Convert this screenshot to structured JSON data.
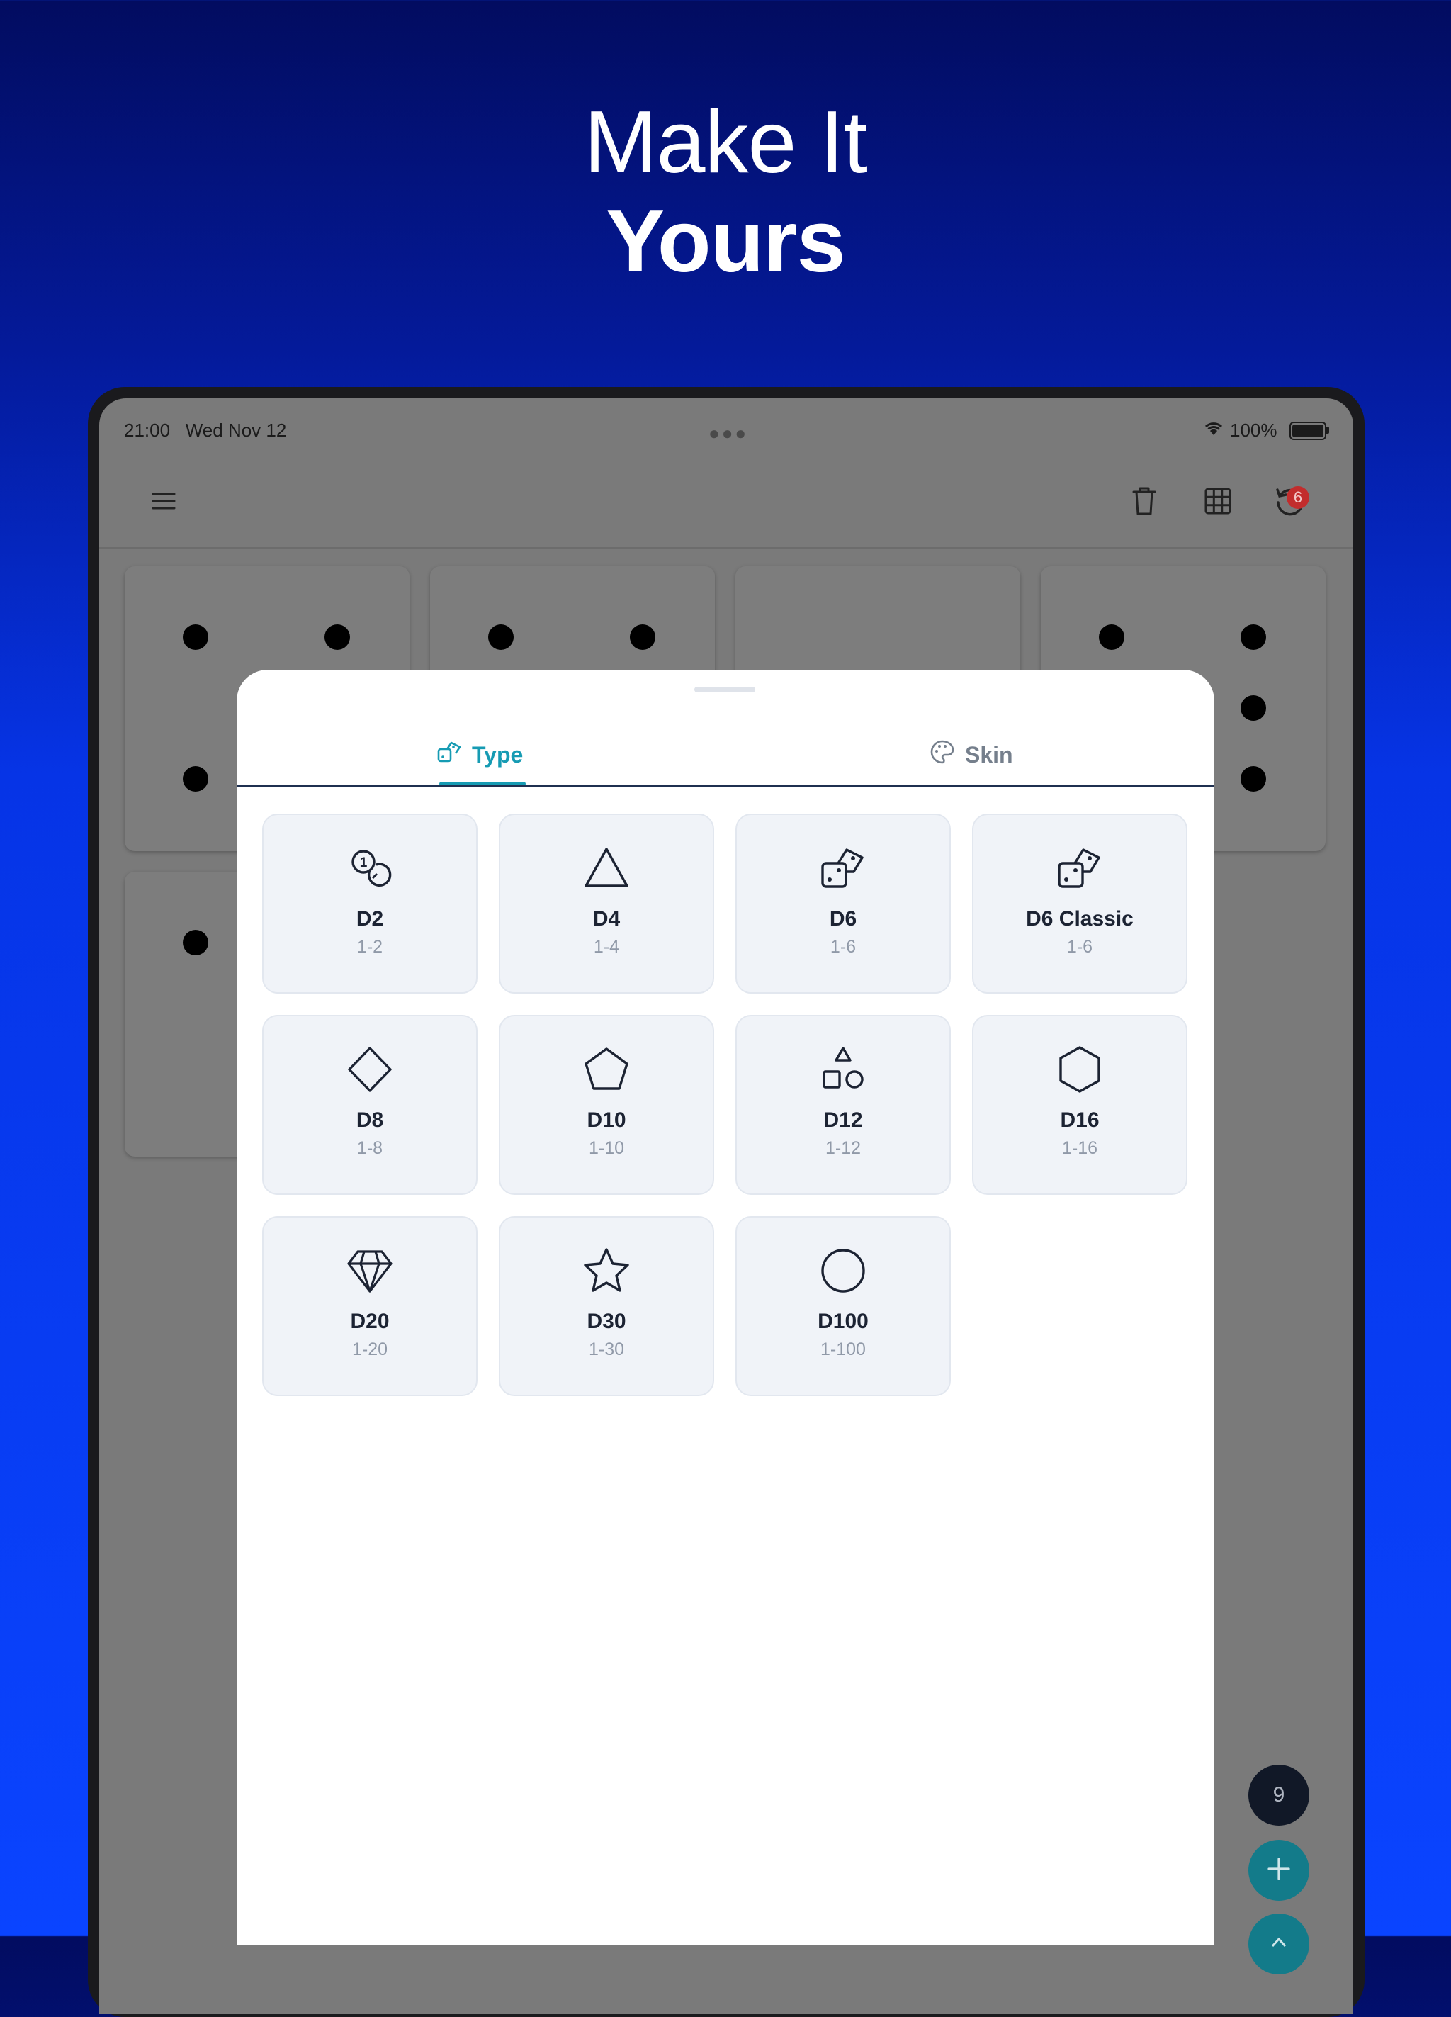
{
  "headline": {
    "line1": "Make It",
    "line2": "Yours"
  },
  "status_bar": {
    "time_date": "21:00   Wed Nov 12",
    "battery_pct": "100%"
  },
  "toolbar": {
    "history_badge_count": "6"
  },
  "sheet": {
    "tabs": [
      {
        "label": "Type",
        "active": true
      },
      {
        "label": "Skin",
        "active": false
      }
    ],
    "dice_types": [
      {
        "name": "D2",
        "range": "1-2",
        "icon": "coins-icon"
      },
      {
        "name": "D4",
        "range": "1-4",
        "icon": "triangle-icon"
      },
      {
        "name": "D6",
        "range": "1-6",
        "icon": "dice-icon"
      },
      {
        "name": "D6 Classic",
        "range": "1-6",
        "icon": "dice-icon"
      },
      {
        "name": "D8",
        "range": "1-8",
        "icon": "diamond-icon"
      },
      {
        "name": "D10",
        "range": "1-10",
        "icon": "pentagon-icon"
      },
      {
        "name": "D12",
        "range": "1-12",
        "icon": "shapes-icon"
      },
      {
        "name": "D16",
        "range": "1-16",
        "icon": "hexagon-icon"
      },
      {
        "name": "D20",
        "range": "1-20",
        "icon": "gem-icon"
      },
      {
        "name": "D30",
        "range": "1-30",
        "icon": "star-icon"
      },
      {
        "name": "D100",
        "range": "1-100",
        "icon": "circle-icon"
      }
    ]
  },
  "fab": {
    "dice_count": "9"
  },
  "colors": {
    "accent": "#169bb3",
    "fab_teal": "#137b8a",
    "badge_red": "#c22d2d"
  }
}
